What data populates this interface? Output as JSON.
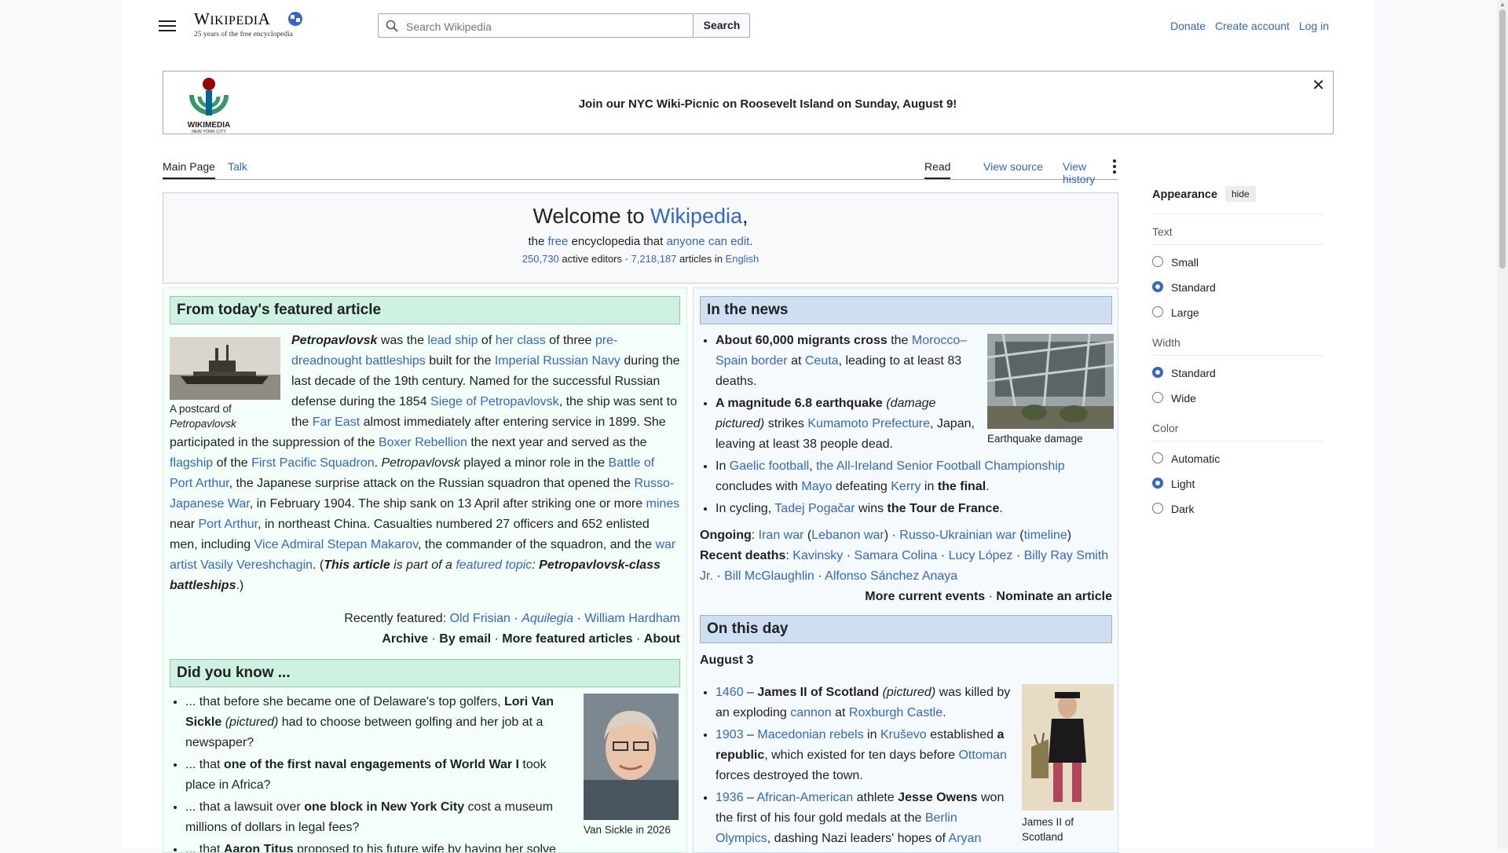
{
  "header": {
    "logo_wordmark": "Wikipedia",
    "logo_tagline": "25 years of the free encyclopedia",
    "search_placeholder": "Search Wikipedia",
    "search_button": "Search",
    "donate": "Donate",
    "create_account": "Create account",
    "log_in": "Log in"
  },
  "banner": {
    "logo_text": "WIKIMEDIA",
    "logo_subtext": "NEW YORK CITY",
    "message": "Join our NYC Wiki-Picnic on Roosevelt Island on Sunday, August 9!",
    "close": "✕"
  },
  "tabs": {
    "main_page": "Main Page",
    "talk": "Talk",
    "read": "Read",
    "view_source": "View source",
    "view_history": "View history"
  },
  "welcome": {
    "title_pre": "Welcome to ",
    "title_link": "Wikipedia",
    "title_post": ",",
    "sub_1": "the ",
    "sub_free": "free",
    "sub_2": " encyclopedia that ",
    "sub_anyone": "anyone can edit",
    "sub_3": ".",
    "editors": "250,730",
    "editors_label": " active editors · ",
    "articles": "7,218,187",
    "articles_label": " articles in ",
    "language": "English"
  },
  "featured": {
    "heading": "From today's featured article",
    "caption_1": "A postcard of",
    "caption_2": "Petropavlovsk",
    "recently_label": "Recently featured: ",
    "recent_1": "Old Frisian",
    "recent_2": "Aquilegia",
    "recent_3": "William Hardham",
    "archive": "Archive",
    "by_email": "By email",
    "more": "More featured articles",
    "about": "About"
  },
  "dyk": {
    "heading": "Did you know ...",
    "caption": "Van Sickle in 2026",
    "item1_pre": "... that before she became one of Delaware's top golfers, ",
    "item1_link": "Lori Van Sickle",
    "item1_mid": " (pictured)",
    "item1_post": " had to choose between golfing and her job at a newspaper?",
    "item2_pre": "... that ",
    "item2_link": "one of the first naval engagements of World War I",
    "item2_post": " took place in Africa?",
    "item3_pre": "... that a lawsuit over ",
    "item3_link": "one block in New York City",
    "item3_post": " cost a museum millions of dollars in legal fees?",
    "item4_pre": "... that ",
    "item4_link": "Aaron Titus",
    "item4_post": " proposed to his future wife by having her solve"
  },
  "news": {
    "heading": "In the news",
    "caption": "Earthquake damage",
    "ongoing_label": "Ongoing",
    "recent_deaths_label": "Recent deaths",
    "more_events": "More current events",
    "nominate": "Nominate an article"
  },
  "otd": {
    "heading": "On this day",
    "date": "August 3",
    "caption_1": "James II of",
    "caption_2": "Scotland"
  },
  "appearance": {
    "title": "Appearance",
    "hide": "hide",
    "text_title": "Text",
    "text_options": [
      "Small",
      "Standard",
      "Large"
    ],
    "text_selected": "Standard",
    "width_title": "Width",
    "width_options": [
      "Standard",
      "Wide"
    ],
    "width_selected": "Standard",
    "color_title": "Color",
    "color_options": [
      "Automatic",
      "Light",
      "Dark"
    ],
    "color_selected": "Light"
  },
  "colors": {
    "link": "#3366cc",
    "featured_bg": "#f5fffa",
    "featured_heading": "#cef2e0",
    "news_bg": "#f5faff",
    "news_heading": "#cedff2"
  }
}
